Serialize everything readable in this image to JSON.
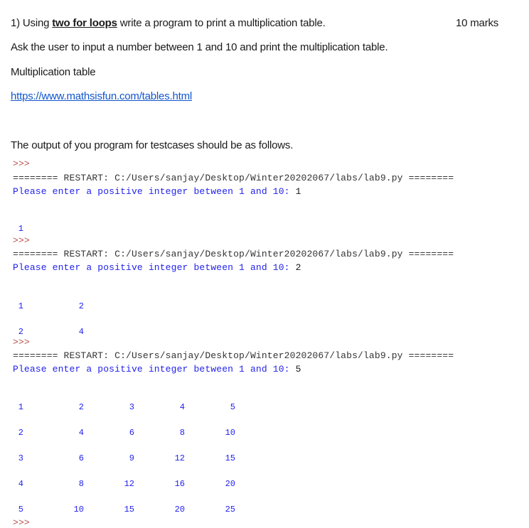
{
  "question": {
    "number": "1)",
    "prefix": "Using ",
    "emphasis": "two for loops",
    "suffix": " write a program to print a multiplication table.",
    "marks": "10 marks"
  },
  "instruction": "Ask the user to input a number between 1 and 10 and print the multiplication table.",
  "reference_label": "Multiplication table",
  "reference_link": "https://www.mathsisfun.com/tables.html",
  "output_intro": "The output of you program for testcases should be as follows.",
  "shell": {
    "prompt": ">>>",
    "restart_line": "======== RESTART: C:/Users/sanjay/Desktop/Winter20202067/labs/lab9.py ========",
    "ask_text": "Please enter a positive integer between 1 and 10: ",
    "runs": [
      {
        "input": "1",
        "table": [
          [
            "1"
          ]
        ]
      },
      {
        "input": "2",
        "table": [
          [
            "1",
            "2"
          ],
          [
            "2",
            "4"
          ]
        ]
      },
      {
        "input": "5",
        "table": [
          [
            "1",
            "2",
            "3",
            "4",
            "5"
          ],
          [
            "2",
            "4",
            "6",
            "8",
            "10"
          ],
          [
            "3",
            "6",
            "9",
            "12",
            "15"
          ],
          [
            "4",
            "8",
            "12",
            "16",
            "20"
          ],
          [
            "5",
            "10",
            "15",
            "20",
            "25"
          ]
        ]
      }
    ]
  }
}
